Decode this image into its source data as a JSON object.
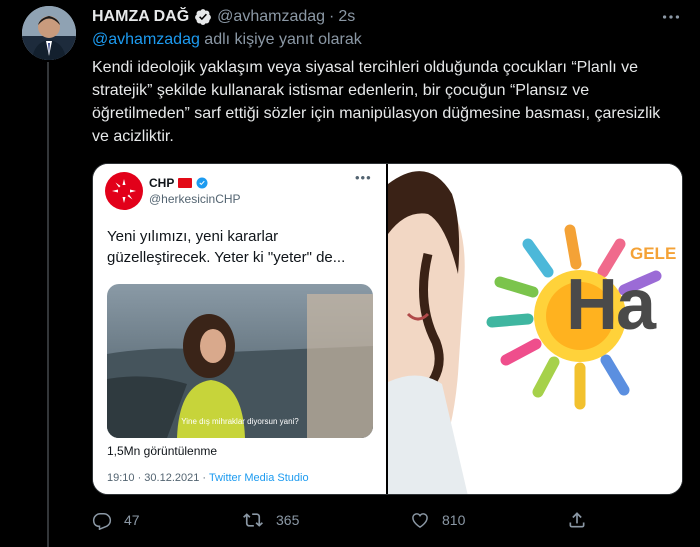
{
  "tweet": {
    "display_name": "HAMZA DAĞ",
    "handle": "@avhamzadag",
    "separator": "·",
    "time": "2s",
    "reply_mention": "@avhamzadag",
    "reply_suffix": " adlı kişiye yanıt olarak",
    "text": "Kendi ideolojik yaklaşım veya siyasal tercihleri olduğunda çocukları “Planlı ve stratejik” şekilde kullanarak istismar edenlerin, bir çocuğun “Plansız ve öğretilmeden” sarf ettiği sözler için  manipülasyon düğmesine basması, çaresizlik ve acizliktir."
  },
  "embedded": {
    "name": "CHP",
    "handle": "@herkesicinCHP",
    "text": "Yeni yılımızı, yeni kararlar güzelleştirecek. Yeter ki \"yeter\" de...",
    "video_caption": "Yine dış mihraklar diyorsun yani?",
    "views": "1,5Mn görüntülenme",
    "date": "19:10 · 30.12.2021 · ",
    "source": "Twitter Media Studio"
  },
  "right_image": {
    "brand_small": "GELE",
    "brand_big": "Ha"
  },
  "actions": {
    "reply_count": "47",
    "retweet_count": "365",
    "like_count": "810"
  },
  "icons": [
    "verified-badge-icon",
    "more-icon",
    "reply-icon",
    "retweet-icon",
    "like-icon",
    "share-icon"
  ],
  "colors": {
    "background": "#000000",
    "text": "#e7e9ea",
    "muted": "#8b98a5",
    "link": "#1d9bf0",
    "chp_red": "#e2001a"
  }
}
